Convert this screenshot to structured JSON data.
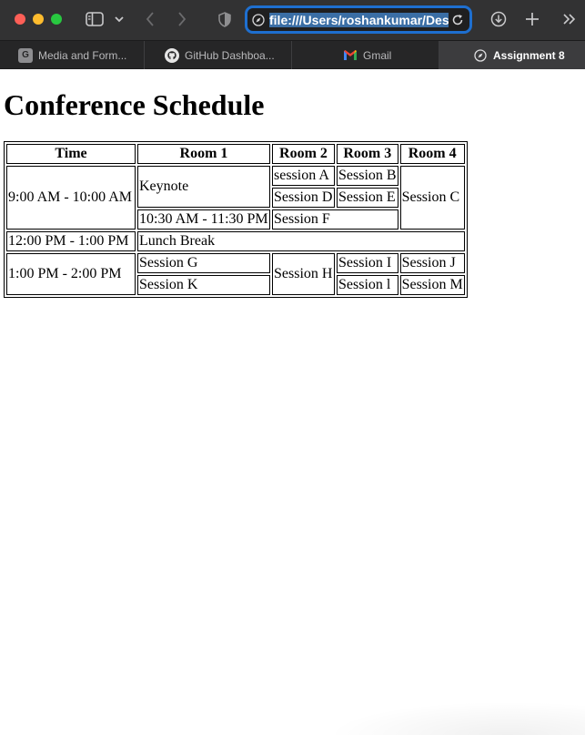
{
  "browser": {
    "url": "file:///Users/roshankumar/Deskto",
    "tabs": [
      {
        "label": "Media and Form...",
        "favicon": "G"
      },
      {
        "label": "GitHub Dashboa...",
        "favicon": "github-icon"
      },
      {
        "label": "Gmail",
        "favicon": "gmail-icon"
      },
      {
        "label": "Assignment 8",
        "favicon": "compass-icon",
        "active": true
      }
    ],
    "colors": {
      "toolbar": "#323233",
      "url_focus": "#1e6fd0",
      "close": "#fe5f57",
      "minimize": "#febc2e",
      "zoom": "#28c840"
    }
  },
  "page": {
    "title": "Conference Schedule",
    "table": {
      "headers": [
        "Time",
        "Room 1",
        "Room 2",
        "Room 3",
        "Room 4"
      ],
      "rows": {
        "time1": "9:00 AM - 10:00 AM",
        "keynote": "Keynote",
        "session_a": "session A",
        "session_b": "Session B",
        "session_c": "Session C",
        "session_d": "Session D",
        "session_e": "Session E",
        "time2": "10:30 AM - 11:30 PM",
        "session_f": "Session F",
        "time3": "12:00 PM - 1:00 PM",
        "lunch": "Lunch Break",
        "time4": "1:00 PM - 2:00 PM",
        "session_g": "Session G",
        "session_h": "Session H",
        "session_i": "Session I",
        "session_j": "Session J",
        "session_k": "Session K",
        "session_l": "Session l",
        "session_m": "Session M"
      }
    }
  }
}
